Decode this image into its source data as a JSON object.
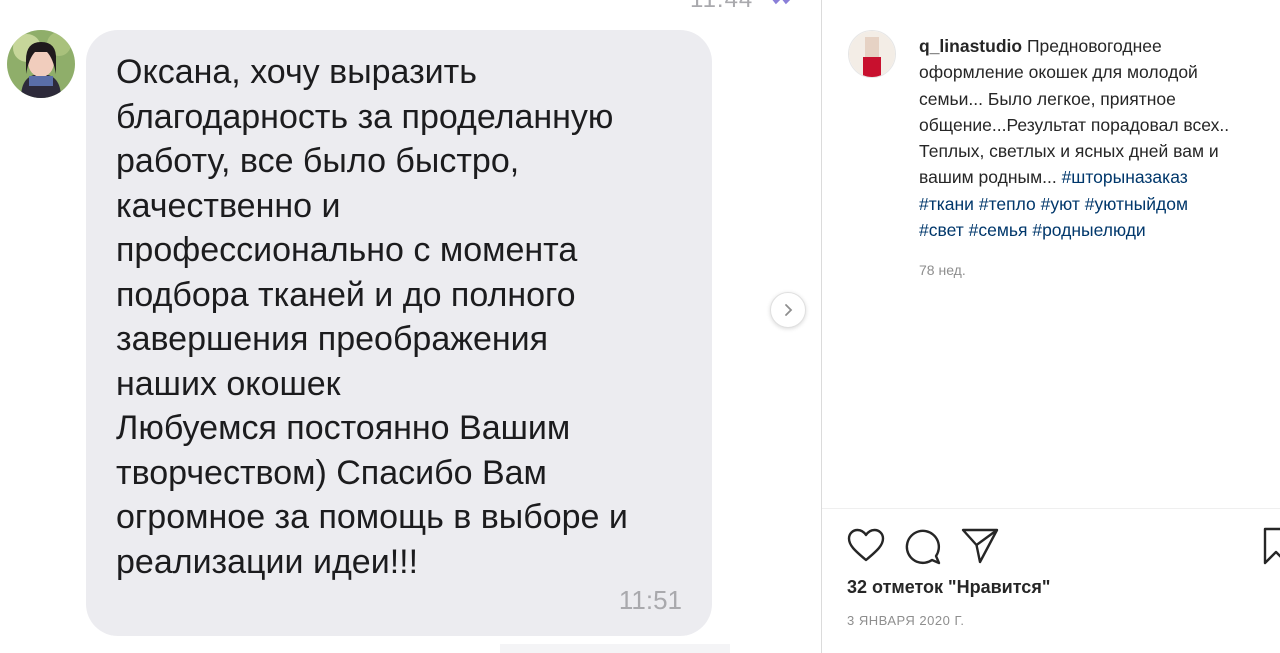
{
  "chat": {
    "previous_time": "11:44",
    "message_lines": [
      "Оксана, хочу выразить",
      "благодарность за проделанную",
      "работу, все было быстро,",
      "качественно и",
      "профессионально с момента",
      "подбора тканей и до полного",
      "завершения преображения",
      "наших окошек",
      "Любуемся постоянно Вашим",
      "творчеством) Спасибо Вам",
      "огромное за помощь в выборе и",
      "реализации идеи!!!"
    ],
    "message_time": "11:51"
  },
  "post": {
    "username": "q_linastudio",
    "caption_line1": "Предновогоднее",
    "caption_line2": "оформление окошек для молодой",
    "caption_line3": "семьи... Было легкое, приятное",
    "caption_line4": "общение...Результат порадовал всех..",
    "caption_line5": "Теплых, светлых и ясных дней вам и",
    "caption_line6_text": "вашим родным... ",
    "hashtags": [
      "#шторыназаказ",
      "#ткани",
      "#тепло",
      "#уют",
      "#уютныйдом",
      "#свет",
      "#семья",
      "#родныелюди"
    ],
    "age": "78 нед.",
    "likes": "32 отметок \"Нравится\"",
    "date": "3 ЯНВАРЯ 2020 Г."
  },
  "icons": {
    "like": "heart-icon",
    "comment": "comment-icon",
    "share": "share-icon",
    "save": "bookmark-icon",
    "next": "chevron-right-icon"
  },
  "colors": {
    "bubble": "#ececf0",
    "hashtag": "#00376b",
    "text": "#262626",
    "meta": "#8e8e8e"
  }
}
